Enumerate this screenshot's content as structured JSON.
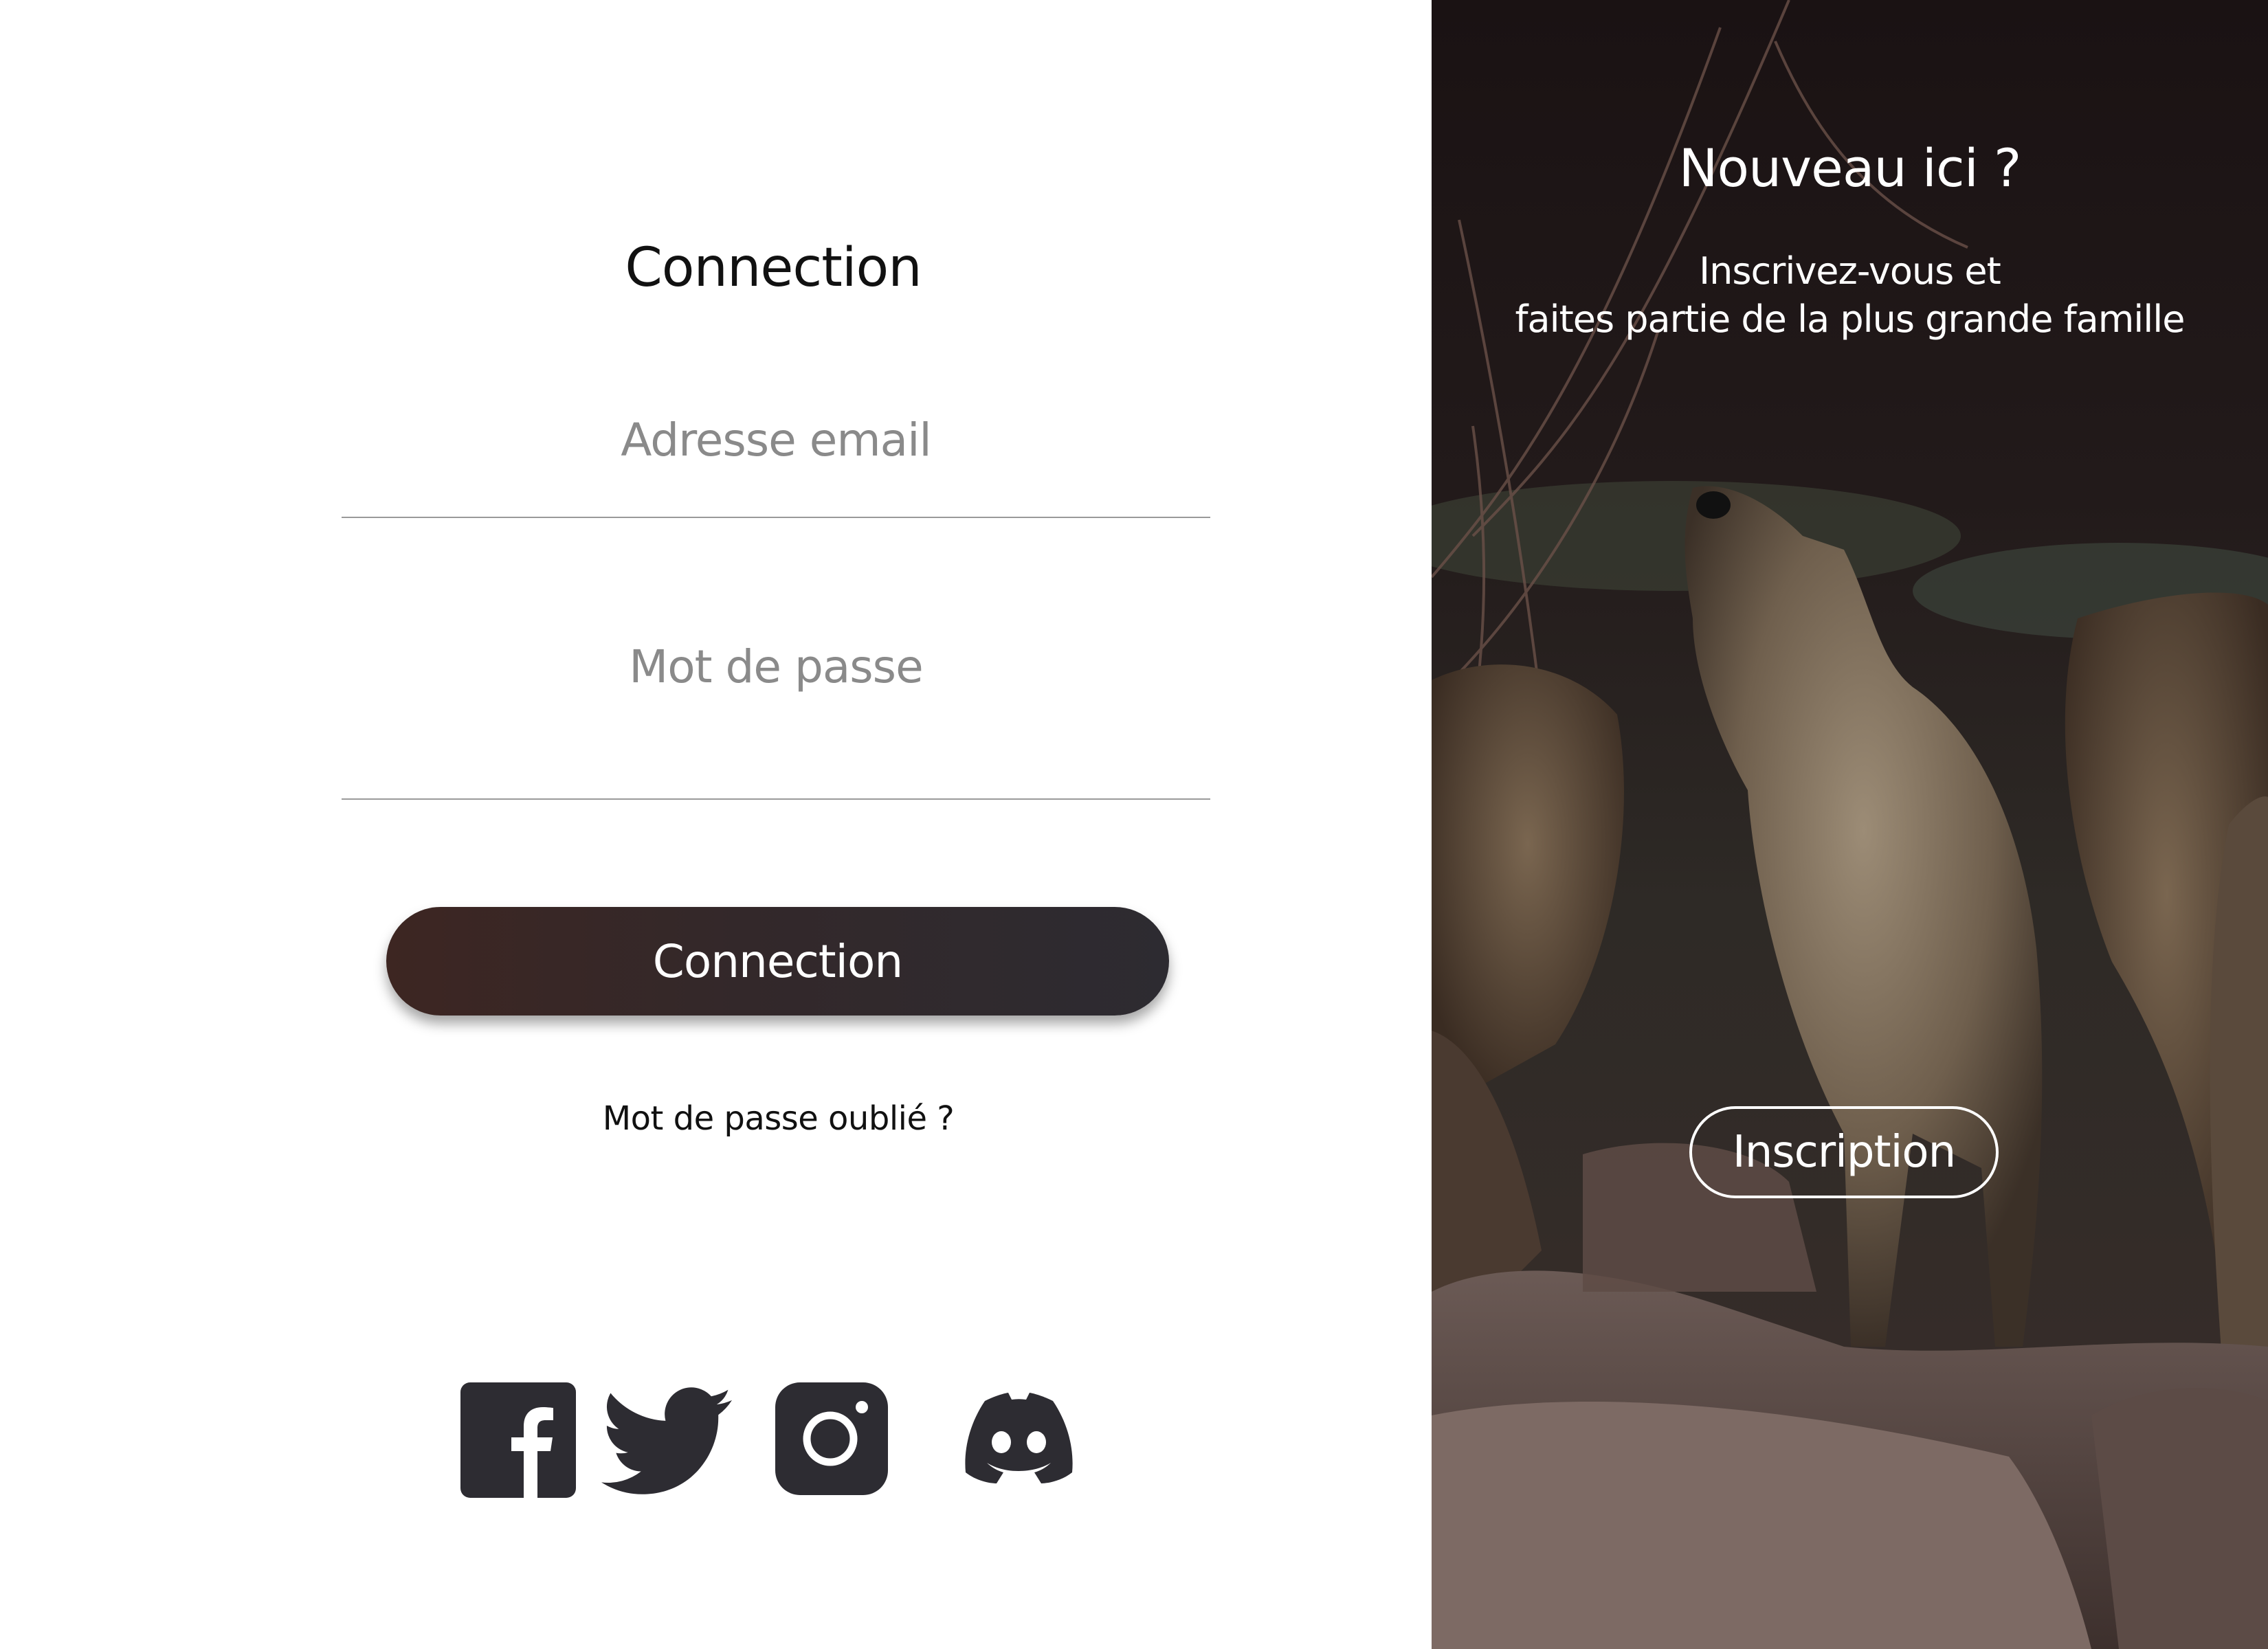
{
  "login": {
    "title": "Connection",
    "email_placeholder": "Adresse email",
    "password_placeholder": "Mot de passe",
    "submit_label": "Connection",
    "forgot_label": "Mot de passe oublié ?"
  },
  "social": {
    "icons": [
      "facebook-icon",
      "twitter-icon",
      "instagram-icon",
      "discord-icon"
    ],
    "icon_color": "#2d2c32"
  },
  "signup": {
    "title": "Nouveau ici ?",
    "text_line1": "Inscrivez-vous et",
    "text_line2": "faites partie de la plus grande famille",
    "button_label": "Inscription"
  },
  "colors": {
    "button_gradient_start": "#3d2622",
    "button_gradient_end": "#2d2b31",
    "field_underline": "#9a9a9a",
    "placeholder": "#8a8a8a"
  }
}
